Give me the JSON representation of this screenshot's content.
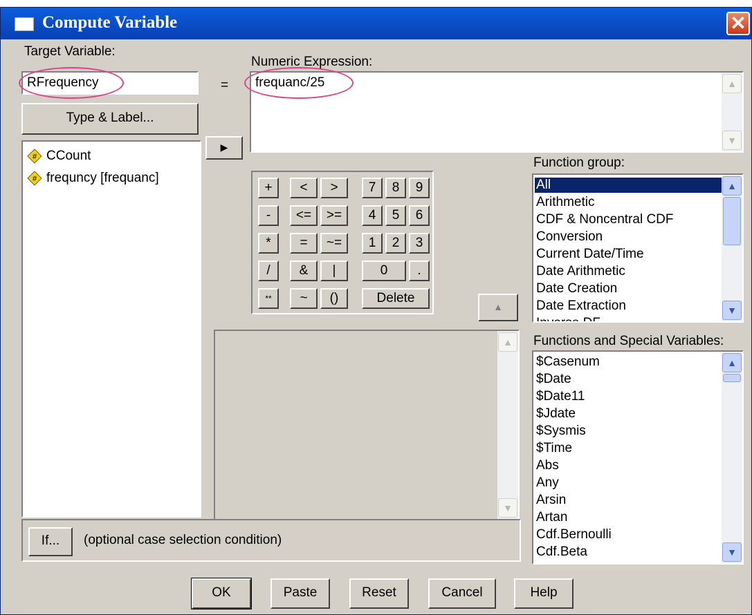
{
  "window": {
    "title": "Compute Variable"
  },
  "target_variable": {
    "label": "Target Variable:",
    "value": "RFrequency",
    "type_label_button": "Type & Label..."
  },
  "equals_sign": "=",
  "numeric_expression": {
    "label": "Numeric Expression:",
    "value": "frequanc/25"
  },
  "variables": [
    {
      "name": "CCount"
    },
    {
      "name": "frequncy [frequanc]"
    }
  ],
  "keypad": {
    "row1": [
      "+",
      "<",
      ">",
      "7",
      "8",
      "9"
    ],
    "row2": [
      "-",
      "<=",
      ">=",
      "4",
      "5",
      "6"
    ],
    "row3": [
      "*",
      "=",
      "~=",
      "1",
      "2",
      "3"
    ],
    "row4": [
      "/",
      "&",
      "|",
      "0",
      "."
    ],
    "row5": [
      "**",
      "~",
      "()",
      "Delete"
    ]
  },
  "function_group": {
    "label": "Function group:",
    "items": [
      "All",
      "Arithmetic",
      "CDF & Noncentral CDF",
      "Conversion",
      "Current Date/Time",
      "Date Arithmetic",
      "Date Creation",
      "Date Extraction",
      "Inverse DF"
    ],
    "selected": "All"
  },
  "functions": {
    "label": "Functions and Special Variables:",
    "items": [
      "$Casenum",
      "$Date",
      "$Date11",
      "$Jdate",
      "$Sysmis",
      "$Time",
      "Abs",
      "Any",
      "Arsin",
      "Artan",
      "Cdf.Bernoulli",
      "Cdf.Beta"
    ]
  },
  "if_section": {
    "button": "If...",
    "text": "(optional case selection condition)"
  },
  "buttons": {
    "ok": "OK",
    "paste": "Paste",
    "reset": "Reset",
    "cancel": "Cancel",
    "help": "Help"
  },
  "colors": {
    "titlebar": "#0b4fc8",
    "selection": "#0a246a",
    "highlight_oval": "#e0428a",
    "dialog_bg": "#d4d0c8"
  }
}
